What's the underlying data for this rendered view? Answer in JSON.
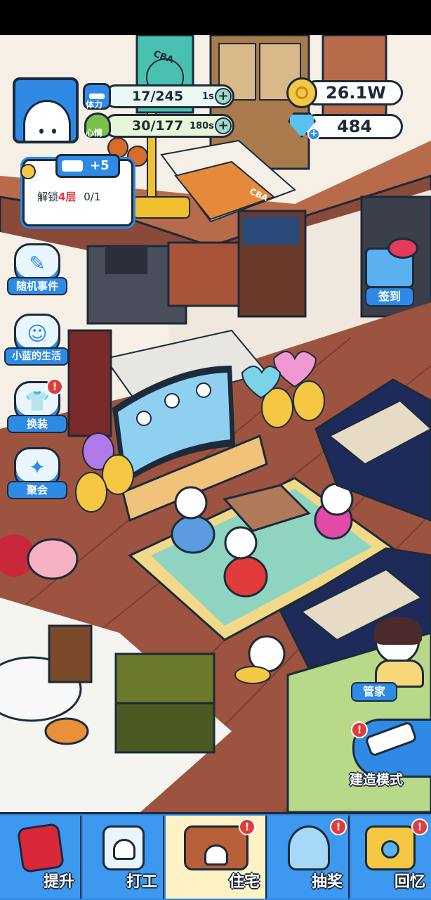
{
  "stats": {
    "stamina": {
      "label": "体力",
      "value": "17/245",
      "timer": "1s"
    },
    "mood": {
      "label": "心情",
      "value": "30/177",
      "timer": "180s"
    }
  },
  "currency": {
    "gold": "26.1W",
    "gems": "484"
  },
  "unlock_task": {
    "reward": "+5",
    "text_prefix": "解锁",
    "text_highlight": "4层",
    "text_progress": "0/1"
  },
  "side_menu": [
    {
      "label": "随机事件",
      "icon": "event-icon"
    },
    {
      "label": "小蓝的生活",
      "icon": "life-icon"
    },
    {
      "label": "换装",
      "icon": "outfit-icon",
      "alert": "!"
    },
    {
      "label": "聚会",
      "icon": "party-icon"
    }
  ],
  "right_menu": {
    "checkin": "签到",
    "butler": "管家",
    "build_mode": "建造模式",
    "build_alert": "!"
  },
  "scene_text": {
    "cba_sign": "CBA",
    "cba_floor": "CBA"
  },
  "bottom_nav": [
    {
      "label": "提升",
      "icon": "book-icon",
      "active": false
    },
    {
      "label": "打工",
      "icon": "badge-icon",
      "active": false
    },
    {
      "label": "住宅",
      "icon": "house-icon",
      "active": true,
      "alert": "!"
    },
    {
      "label": "抽奖",
      "icon": "gacha-icon",
      "active": false,
      "alert": "!"
    },
    {
      "label": "回忆",
      "icon": "camera-icon",
      "active": false,
      "alert": "!"
    }
  ],
  "colors": {
    "accent": "#2f8ae6",
    "outline": "#1c2a3a",
    "alert": "#e23b3b",
    "floor": "#8a4a3a"
  }
}
